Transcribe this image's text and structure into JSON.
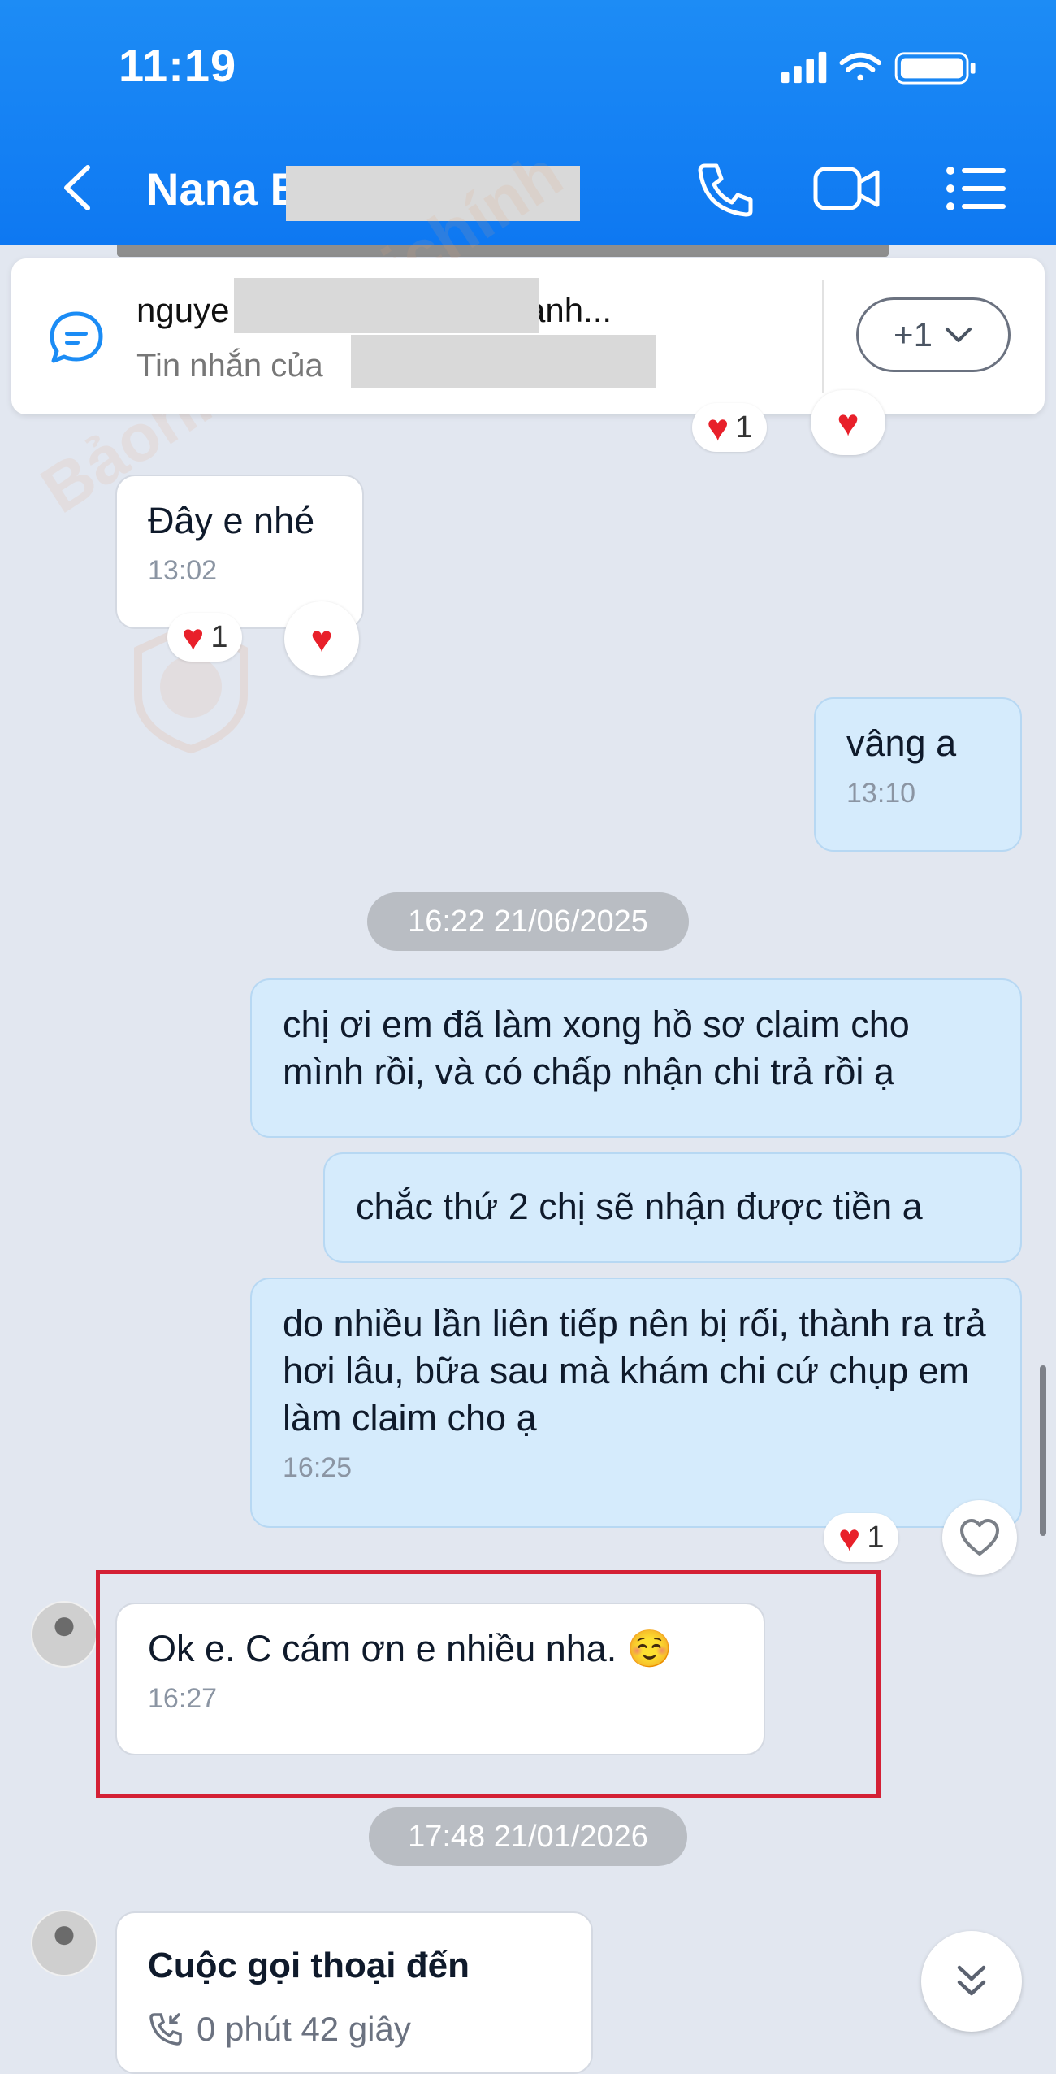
{
  "status_bar": {
    "time": "11:19"
  },
  "header": {
    "contact_name": "Nana B",
    "icons": [
      "back-chevron-icon",
      "phone-icon",
      "video-camera-icon",
      "list-menu-icon"
    ]
  },
  "pinned": {
    "title": "nguye",
    "title_tail": "anh...",
    "subtitle": "Tin nhắn của",
    "more_label": "+1"
  },
  "watermark": "Bảohiểm&Tàichính",
  "messages": [
    {
      "text": "Đây e nhé",
      "time": "13:02",
      "reaction_count": "1"
    },
    {
      "text": "vâng a",
      "time": "13:10"
    },
    {
      "date": "16:22 21/06/2025"
    },
    {
      "text": "chị ơi em đã làm xong hồ sơ claim cho mình rồi, và có chấp nhận chi trả rồi ạ"
    },
    {
      "text": "chắc thứ 2 chị sẽ nhận được tiền a"
    },
    {
      "text": "do nhiều lần liên tiếp nên bị rối, thành ra trả hơi lâu, bữa sau mà khám chi cứ chụp em làm claim cho ạ",
      "time": "16:25",
      "reaction_count": "1"
    },
    {
      "text": "Ok e. C cám ơn e nhiều nha. ☺️",
      "time": "16:27"
    },
    {
      "date": "17:48 21/01/2026"
    },
    {
      "title": "Cuộc gọi thoại đến",
      "duration": "0 phút 42 giây"
    }
  ],
  "top_reaction_count": "1",
  "colors": {
    "header": "#0e78f2",
    "outgoing_bubble": "#d5ebfc",
    "highlight_border": "#d42035",
    "background": "#e2e7f0"
  }
}
